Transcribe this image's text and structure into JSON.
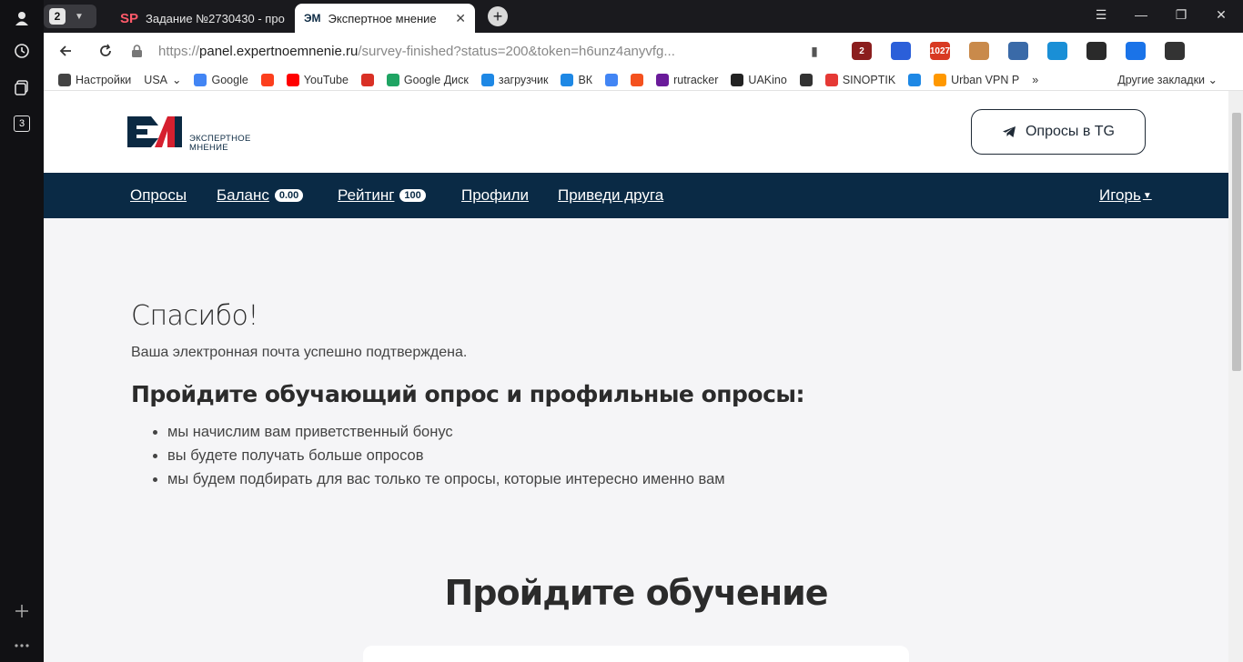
{
  "browser": {
    "tab_count": "2",
    "rail_badge": "3",
    "tabs": [
      {
        "favicon": "SP",
        "title": "Задание №2730430 - про"
      },
      {
        "favicon": "ЭМ",
        "title": "Экспертное мнение"
      }
    ],
    "url_host": "panel.expertnoemnenie.ru",
    "url_path": "/survey-finished?status=200&token=h6unz4anyvfg...",
    "url_scheme": "https://",
    "extensions": [
      {
        "badge": "2",
        "color": "#8b1e1e"
      },
      {
        "badge": "",
        "color": "#2b5fd9"
      },
      {
        "badge": "1027",
        "color": "#d83a22"
      },
      {
        "badge": "",
        "color": "#c98a4b"
      },
      {
        "badge": "",
        "color": "#3a6aa8"
      },
      {
        "badge": "",
        "color": "#1a8fd6"
      },
      {
        "badge": "",
        "color": "#2a2a2a"
      },
      {
        "badge": "",
        "color": "#1a73e8"
      },
      {
        "badge": "",
        "color": "#333333"
      }
    ],
    "bookmarks": [
      {
        "label": "Настройки",
        "icon": "gear-icon",
        "color": "#444444"
      },
      {
        "label": "USA",
        "icon": "",
        "color": ""
      },
      {
        "label": "Google",
        "icon": "google-icon",
        "color": "#4285f4"
      },
      {
        "label": "",
        "icon": "yandex-icon",
        "color": "#fc3f1d"
      },
      {
        "label": "YouTube",
        "icon": "youtube-icon",
        "color": "#ff0000"
      },
      {
        "label": "",
        "icon": "gmail-icon",
        "color": "#d93025"
      },
      {
        "label": "Google Диск",
        "icon": "drive-icon",
        "color": "#1fa463"
      },
      {
        "label": "загрузчик",
        "icon": "loader-icon",
        "color": "#1e88e5"
      },
      {
        "label": "ВК",
        "icon": "vk-icon",
        "color": "#1e88e5"
      },
      {
        "label": "",
        "icon": "translate-icon",
        "color": "#4285f4"
      },
      {
        "label": "",
        "icon": "f-icon",
        "color": "#f4511e"
      },
      {
        "label": "rutracker",
        "icon": "rutracker-icon",
        "color": "#6a1b9a"
      },
      {
        "label": "UAKino",
        "icon": "uakino-icon",
        "color": "#222222"
      },
      {
        "label": "",
        "icon": "chess-icon",
        "color": "#333333"
      },
      {
        "label": "SINOPTIK",
        "icon": "thermometer-icon",
        "color": "#e53935"
      },
      {
        "label": "",
        "icon": "p-icon",
        "color": "#1e88e5"
      },
      {
        "label": "Urban VPN P",
        "icon": "rainbow-icon",
        "color": "#ff9800"
      }
    ],
    "bookmarks_more": "»",
    "other_bookmarks": "Другие закладки"
  },
  "site": {
    "logo_line1": "ЭКСПЕРТНОЕ",
    "logo_line2": "МНЕНИЕ",
    "tg_button": "Опросы в TG",
    "nav": {
      "surveys": "Опросы",
      "balance": "Баланс",
      "balance_value": "0.00",
      "rating": "Рейтинг",
      "rating_value": "100",
      "profiles": "Профили",
      "invite": "Приведи друга",
      "user": "Игорь"
    },
    "brand_colors": {
      "navy": "#0a2a45",
      "red": "#d6202f"
    }
  },
  "main": {
    "thanks_title": "Спасибо!",
    "confirm_text": "Ваша электронная почта успешно подтверждена.",
    "sub_title": "Пройдите обучающий опрос и профильные опросы:",
    "bullets": [
      "мы начислим вам приветственный бонус",
      "вы будете получать больше опросов",
      "мы будем подбирать для вас только те опросы, которые интересно именно вам"
    ],
    "training_title": "Пройдите обучение"
  }
}
